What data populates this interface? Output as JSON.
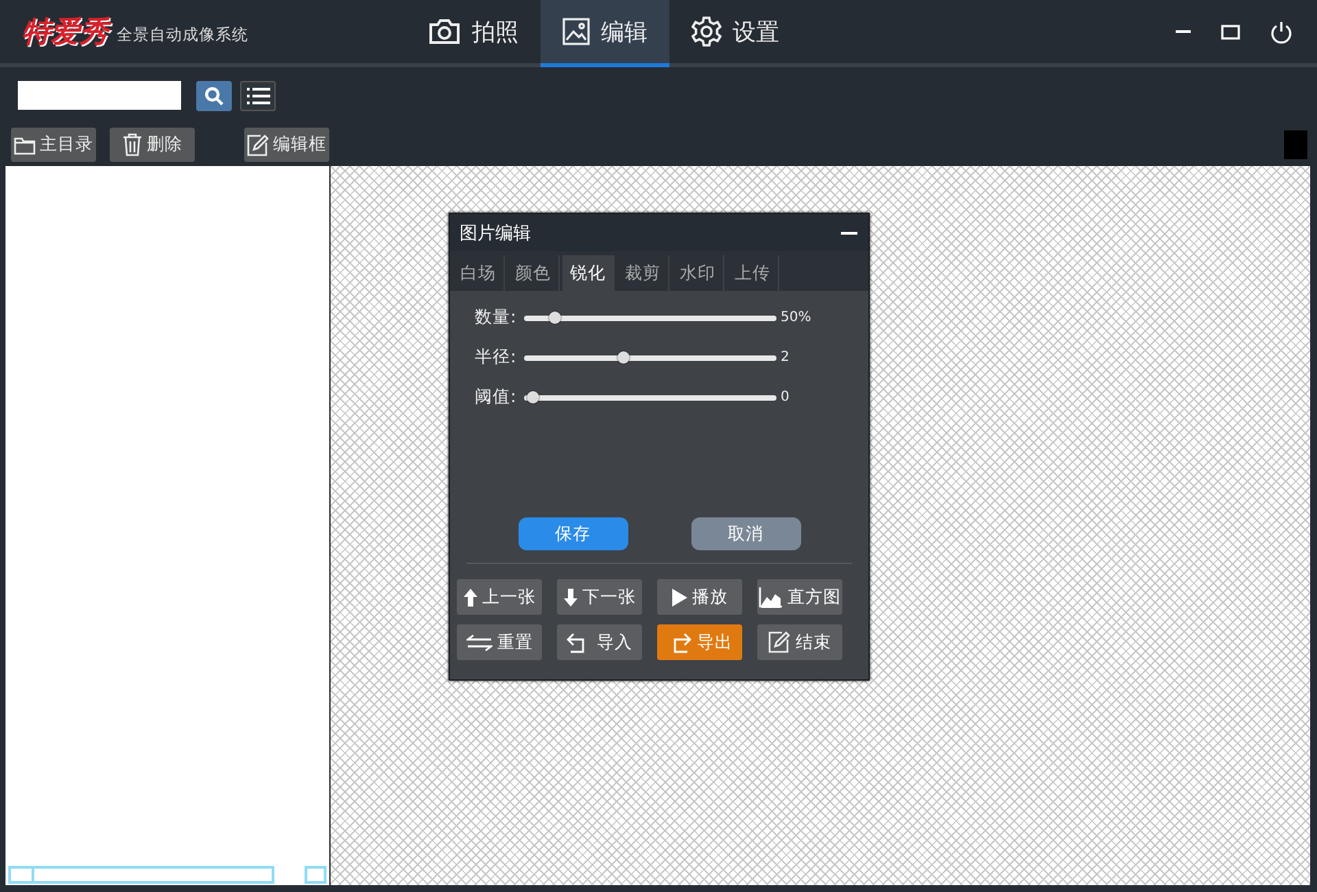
{
  "app": {
    "logo": "特爱秀",
    "subtitle": "全景自动成像系统"
  },
  "nav_tabs": [
    {
      "label": "拍照",
      "kind": "camera",
      "selected": false
    },
    {
      "label": "编辑",
      "kind": "image",
      "selected": true
    },
    {
      "label": "设置",
      "kind": "gear",
      "selected": false
    }
  ],
  "toolbar": [
    {
      "label": "主目录",
      "kind": "folder"
    },
    {
      "label": "删除",
      "kind": "trash"
    },
    {
      "label": "编辑框",
      "kind": "edit"
    }
  ],
  "dialog": {
    "title": "图片编辑",
    "tabs": [
      {
        "label": "白场",
        "selected": false
      },
      {
        "label": "颜色",
        "selected": false
      },
      {
        "label": "锐化",
        "selected": true
      },
      {
        "label": "裁剪",
        "selected": false
      },
      {
        "label": "水印",
        "selected": false
      },
      {
        "label": "上传",
        "selected": false
      }
    ],
    "sliders": [
      {
        "label": "数量:",
        "level": 0.1,
        "reading": "50%"
      },
      {
        "label": "半径:",
        "level": 0.39,
        "reading": "2"
      },
      {
        "label": "阈值:",
        "level": 0.01,
        "reading": "0"
      }
    ],
    "save": "保存",
    "cancel": "取消",
    "actions": [
      {
        "label": "上一张",
        "kind": "up",
        "highlighted": false
      },
      {
        "label": "下一张",
        "kind": "down",
        "highlighted": false
      },
      {
        "label": "播放",
        "kind": "play",
        "highlighted": false
      },
      {
        "label": "直方图",
        "kind": "chart",
        "highlighted": false
      },
      {
        "label": "重置",
        "kind": "swap",
        "highlighted": false
      },
      {
        "label": "导入",
        "kind": "import",
        "highlighted": false
      },
      {
        "label": "导出",
        "kind": "export",
        "highlighted": true
      },
      {
        "label": "结束",
        "kind": "edit",
        "highlighted": false
      }
    ]
  }
}
